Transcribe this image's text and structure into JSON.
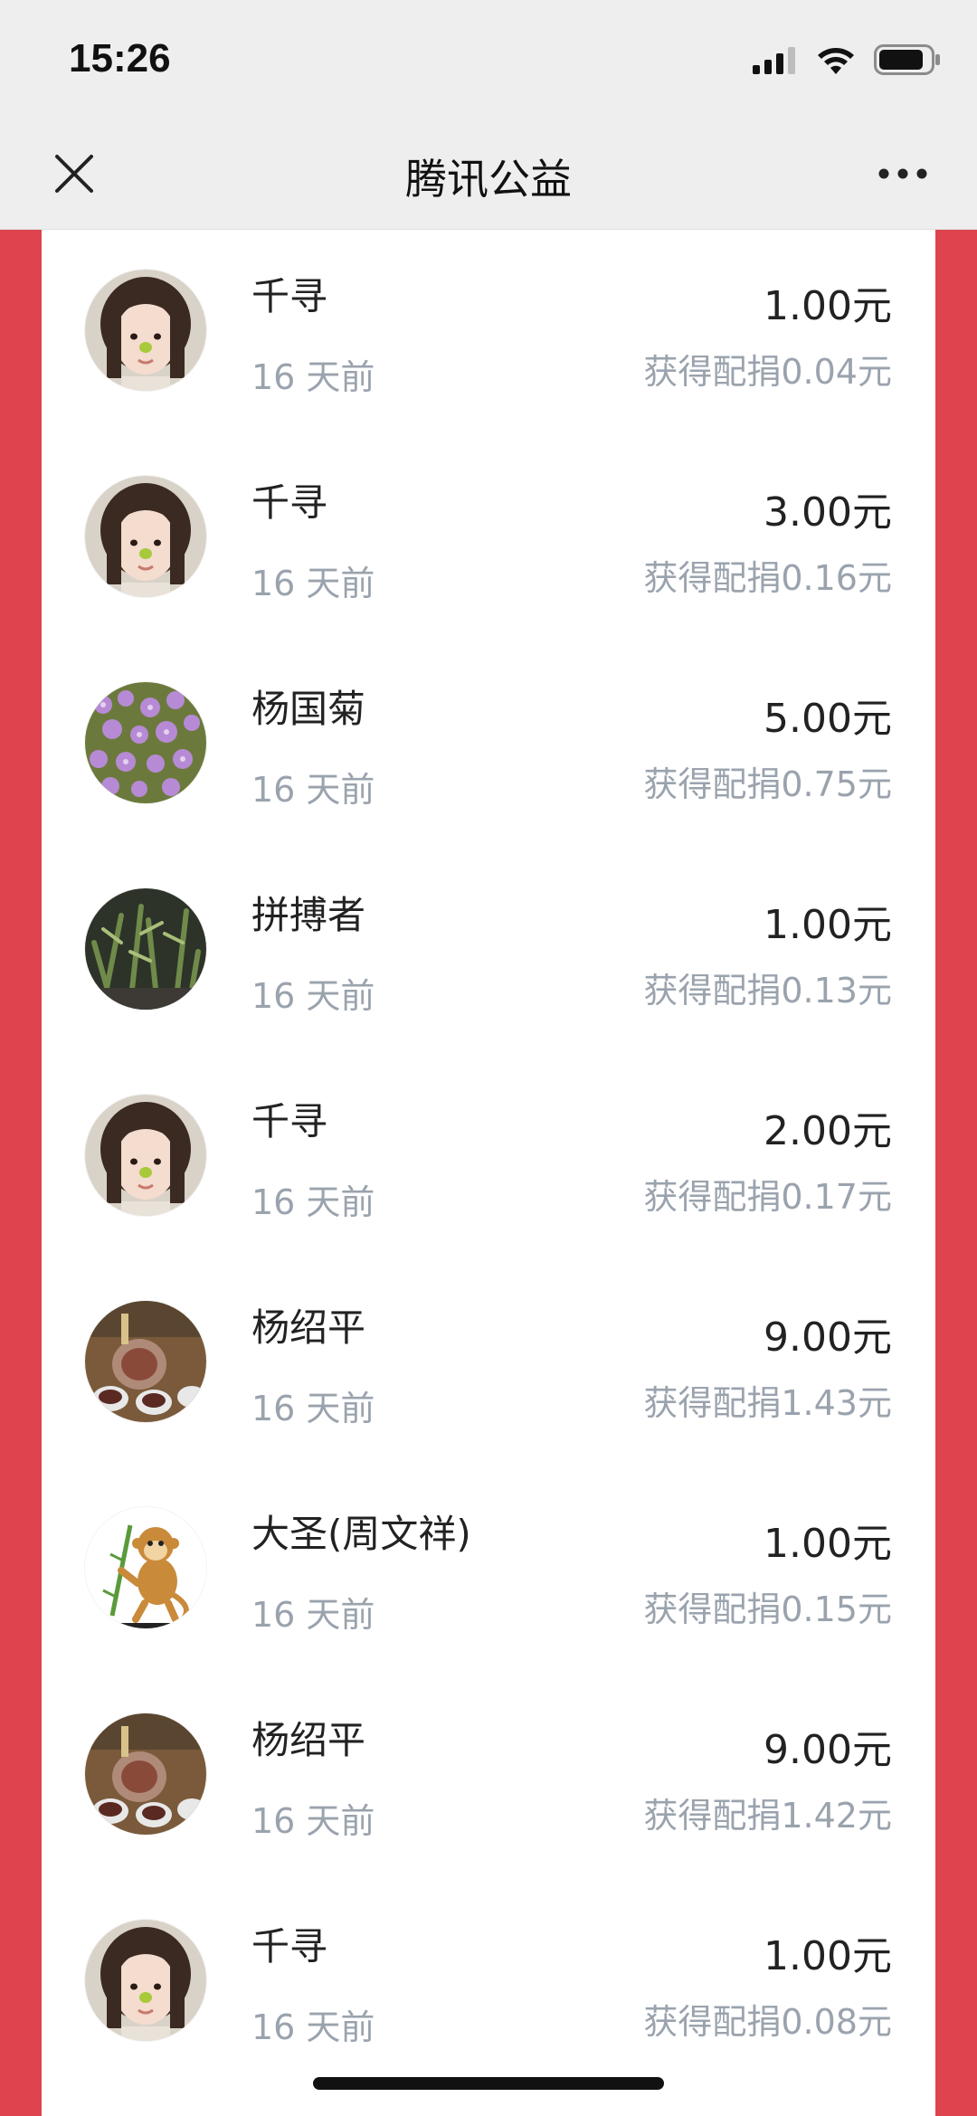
{
  "status_bar": {
    "time": "15:26"
  },
  "nav": {
    "title": "腾讯公益",
    "close_icon": "close-icon",
    "more_icon": "more-icon"
  },
  "colors": {
    "page_background": "#de444d",
    "name_text": "#222222",
    "secondary_text": "#9aa3ad"
  },
  "donations": [
    {
      "name": "千寻",
      "time": "16 天前",
      "amount": "1.00元",
      "match": "获得配捐0.04元",
      "avatar": "girl-portrait-avatar"
    },
    {
      "name": "千寻",
      "time": "16 天前",
      "amount": "3.00元",
      "match": "获得配捐0.16元",
      "avatar": "girl-portrait-avatar"
    },
    {
      "name": "杨国菊",
      "time": "16 天前",
      "amount": "5.00元",
      "match": "获得配捐0.75元",
      "avatar": "purple-flowers-avatar"
    },
    {
      "name": "拼搏者",
      "time": "16 天前",
      "amount": "1.00元",
      "match": "获得配捐0.13元",
      "avatar": "green-plants-avatar"
    },
    {
      "name": "千寻",
      "time": "16 天前",
      "amount": "2.00元",
      "match": "获得配捐0.17元",
      "avatar": "girl-portrait-avatar"
    },
    {
      "name": "杨绍平",
      "time": "16 天前",
      "amount": "9.00元",
      "match": "获得配捐1.43元",
      "avatar": "tea-set-avatar"
    },
    {
      "name": "大圣(周文祥)",
      "time": "16 天前",
      "amount": "1.00元",
      "match": "获得配捐0.15元",
      "avatar": "monkey-cartoon-avatar"
    },
    {
      "name": "杨绍平",
      "time": "16 天前",
      "amount": "9.00元",
      "match": "获得配捐1.42元",
      "avatar": "tea-set-avatar"
    },
    {
      "name": "千寻",
      "time": "16 天前",
      "amount": "1.00元",
      "match": "获得配捐0.08元",
      "avatar": "girl-portrait-avatar"
    }
  ]
}
